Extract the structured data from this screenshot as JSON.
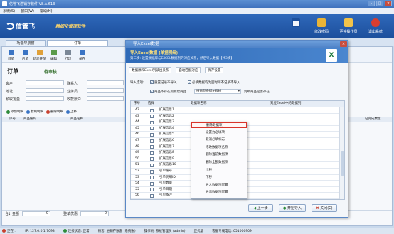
{
  "window": {
    "title": "信管飞进销存软件 V8.A.613"
  },
  "menu": [
    "系统(S)",
    "窗口(W)",
    "帮助(H)"
  ],
  "banner": {
    "brand": "信管飞",
    "slogan": "精细化管理软件"
  },
  "top_buttons": [
    {
      "label": "修改密码",
      "icon": "key-icon",
      "color": "#e9b437"
    },
    {
      "label": "更换操作员",
      "icon": "user-switch-icon",
      "color": "#f2c34a"
    },
    {
      "label": "退出系统",
      "icon": "power-icon",
      "color": "#d93d2f"
    }
  ],
  "tabs": [
    {
      "label": "功能导航窗"
    },
    {
      "label": "订单"
    }
  ],
  "toolbar": [
    "首单",
    "后单",
    "新建开单",
    "编辑",
    "打印",
    "保存"
  ],
  "order": {
    "title": "订单",
    "status": "待审核",
    "fields": [
      "客户",
      "联系人",
      "地址",
      "业务员",
      "预收定金",
      "收款账户"
    ]
  },
  "lines_toolbar": [
    {
      "label": "添加明细",
      "color": "#2e8b3a"
    },
    {
      "label": "复制明细",
      "color": "#3a74c4"
    },
    {
      "label": "删除明细",
      "color": "#c8412f"
    },
    {
      "label": "上移",
      "color": "#3a74c4"
    }
  ],
  "grid_headers": [
    "序号",
    "商品编码",
    "商品名称"
  ],
  "grid_right_header": "已完成数量",
  "summary": {
    "total_label": "合计金额",
    "total_value": "0",
    "discount_label": "整单优惠",
    "discount_value": "0"
  },
  "statusbar": {
    "app": "正在...",
    "server": "IP: 127.0.0.1:7093",
    "conn": "连接状态: 正常",
    "account": "账套: 进销存账套 (系统账)",
    "operator": "操作员: 系统管理员 (admin)",
    "license": "正式版",
    "phone": "客服专线电话: 051006909"
  },
  "dialog": {
    "title": "导入Excel数据",
    "heading": "导入Excel数据 (单据明细)",
    "subheading": "第三步: 设置数据库与EXCEL数据列的对应关系，然后导入数据【共3步】",
    "excel_icon": "X",
    "steps": [
      "数据源和Excel列读出关系",
      "自动匹配对应",
      "保存设置"
    ],
    "options_label": "导入选项:",
    "opt1": "重置记录不导入",
    "opt2": "必填数据均为空时则不记录不导入",
    "opt3": "商品不存在则新建商品",
    "select_value": "按商品条码+规格",
    "select_note": "判断商品是否存在",
    "col_no": "序号",
    "col_select": "选择",
    "col_field": "数据项名称",
    "col_excel": "对应Excel中的数据列",
    "rows": [
      {
        "no": "42",
        "name": "扩展信息1"
      },
      {
        "no": "43",
        "name": "扩展信息2"
      },
      {
        "no": "44",
        "name": "扩展信息3"
      },
      {
        "no": "45",
        "name": "扩展信息4"
      },
      {
        "no": "46",
        "name": "扩展信息5"
      },
      {
        "no": "47",
        "name": "扩展信息6"
      },
      {
        "no": "48",
        "name": "扩展信息7"
      },
      {
        "no": "49",
        "name": "扩展信息8"
      },
      {
        "no": "50",
        "name": "扩展信息9"
      },
      {
        "no": "51",
        "name": "扩展信息10"
      },
      {
        "no": "52",
        "name": "引单编号"
      },
      {
        "no": "53",
        "name": "引单明细ID"
      },
      {
        "no": "54",
        "name": "引单数量"
      },
      {
        "no": "55",
        "name": "引单日期"
      },
      {
        "no": "56",
        "name": "引单备注"
      }
    ],
    "context_menu": [
      "删除数据项",
      "设置为必填项",
      "取消必填标志",
      "修改数据项名称",
      "删除当前数据项",
      "删除全部数据项",
      "上移",
      "下移",
      "导入数据项配置",
      "导出数据项配置"
    ],
    "buttons": {
      "prev": "上一步",
      "import": "开始导入",
      "close": "关闭(C)"
    }
  }
}
